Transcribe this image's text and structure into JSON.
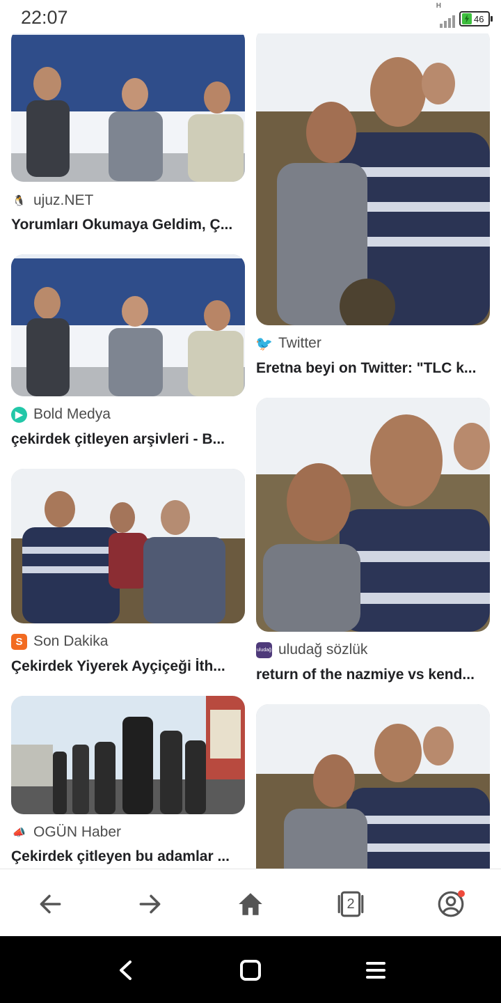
{
  "status_bar": {
    "time": "22:07",
    "network": "H",
    "battery": "46",
    "icons": [
      "signal-icon",
      "battery-icon"
    ]
  },
  "results": [
    {
      "source": "ujuz.NET",
      "favicon": "penguin-icon",
      "favicon_color": "#d23a2a",
      "title": "Yorumları Okumaya Geldim, Ç..."
    },
    {
      "source": "Twitter",
      "favicon": "twitter-bird-icon",
      "favicon_color": "#1d9bf0",
      "title": "Eretna beyi on Twitter: \"TLC k..."
    },
    {
      "source": "Bold Medya",
      "favicon": "play-circle-icon",
      "favicon_color": "#22c7a8",
      "title": "çekirdek çitleyen arşivleri - B..."
    },
    {
      "source": "Son Dakika",
      "favicon": "s-logo-icon",
      "favicon_color": "#f26b21",
      "title": "Çekirdek Yiyerek Ayçiçeği İth..."
    },
    {
      "source": "uludağ sözlük",
      "favicon": "uludag-logo-icon",
      "favicon_color": "#4e3a7a",
      "title": "return of the nazmiye vs kend..."
    },
    {
      "source": "OGÜN Haber",
      "favicon": "megaphone-icon",
      "favicon_color": "#c93030",
      "title": "Çekirdek çitleyen bu adamlar ..."
    }
  ],
  "bottom_nav": {
    "tab_count": "2",
    "icons": [
      "back-arrow-icon",
      "forward-arrow-icon",
      "home-icon",
      "tabs-icon",
      "account-icon"
    ]
  },
  "system_nav": {
    "icons": [
      "back-chevron-icon",
      "home-square-icon",
      "menu-lines-icon"
    ]
  }
}
